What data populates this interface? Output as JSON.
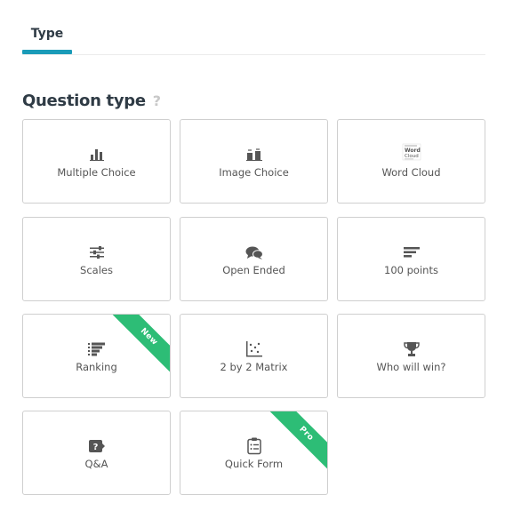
{
  "tabs": [
    {
      "label": "Type"
    }
  ],
  "section": {
    "title": "Question type",
    "help": "?"
  },
  "colors": {
    "accent": "#1a9bb8",
    "ribbon": "#2dbd76",
    "icon": "#555555"
  },
  "question_types": [
    {
      "label": "Multiple Choice",
      "icon": "bar-chart-icon"
    },
    {
      "label": "Image Choice",
      "icon": "image-choice-icon"
    },
    {
      "label": "Word Cloud",
      "icon": "word-cloud-icon",
      "icon_text": [
        "Word",
        "Cloud"
      ]
    },
    {
      "label": "Scales",
      "icon": "sliders-icon"
    },
    {
      "label": "Open Ended",
      "icon": "speech-bubbles-icon"
    },
    {
      "label": "100 points",
      "icon": "lines-icon"
    },
    {
      "label": "Ranking",
      "icon": "ranking-icon",
      "ribbon": "New"
    },
    {
      "label": "2 by 2 Matrix",
      "icon": "scatter-plot-icon"
    },
    {
      "label": "Who will win?",
      "icon": "trophy-icon"
    },
    {
      "label": "Q&A",
      "icon": "question-bubble-icon"
    },
    {
      "label": "Quick Form",
      "icon": "clipboard-icon",
      "ribbon": "Pro"
    }
  ]
}
